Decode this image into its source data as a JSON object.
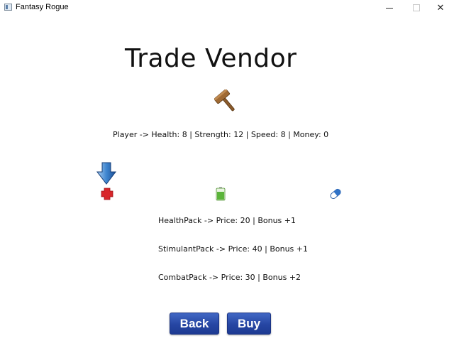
{
  "window": {
    "title": "Fantasy Rogue",
    "min_icon": "minimize-icon",
    "max_icon": "maximize-icon",
    "close_icon": "close-icon",
    "close_glyph": "✕"
  },
  "heading": "Trade Vendor",
  "player_stats": "Player -> Health: 8 | Strength: 12 | Speed: 8 | Money: 0",
  "icons": {
    "vendor": "hammer-icon",
    "selector": "arrow-down-icon",
    "health": "red-cross-icon",
    "stimulant": "battery-icon",
    "combat": "pill-icon"
  },
  "items": [
    {
      "name": "HealthPack",
      "line": "HealthPack -> Price: 20 | Bonus +1"
    },
    {
      "name": "StimulantPack",
      "line": "StimulantPack -> Price: 40 | Bonus +1"
    },
    {
      "name": "CombatPack",
      "line": "CombatPack -> Price: 30 | Bonus +2"
    }
  ],
  "buttons": {
    "back": "Back",
    "buy": "Buy"
  },
  "colors": {
    "button": "#2646a3",
    "cross": "#d8262a",
    "battery": "#5bb43a",
    "arrow": "#2d6fc0",
    "hammer": "#8a5a2b"
  }
}
